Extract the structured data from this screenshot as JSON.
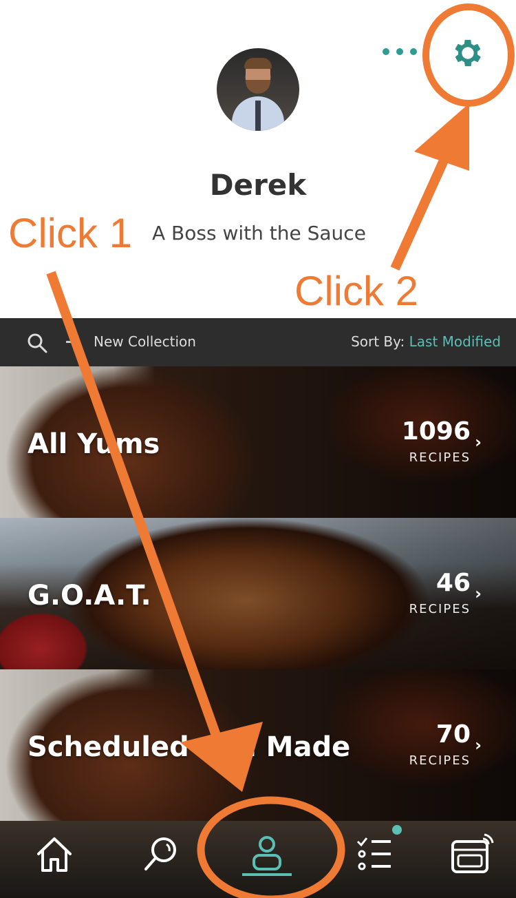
{
  "profile": {
    "name": "Derek",
    "bio": "A Boss with the Sauce"
  },
  "toolbar": {
    "new_collection": "New Collection",
    "sort_label": "Sort By:",
    "sort_value": "Last Modified"
  },
  "collections": [
    {
      "title": "All Yums",
      "count": "1096",
      "unit": "RECIPES"
    },
    {
      "title": "G.O.A.T.",
      "count": "46",
      "unit": "RECIPES"
    },
    {
      "title": "Scheduled and Made",
      "count": "70",
      "unit": "RECIPES"
    }
  ],
  "tabs": [
    "home-icon",
    "search-icon",
    "profile-icon",
    "list-icon",
    "oven-icon"
  ],
  "annotations": {
    "click1": "Click 1",
    "click2": "Click 2"
  },
  "colors": {
    "accent": "#5bbfb5",
    "annotation": "#ef7a33",
    "toolbar": "#2d2d2d"
  }
}
